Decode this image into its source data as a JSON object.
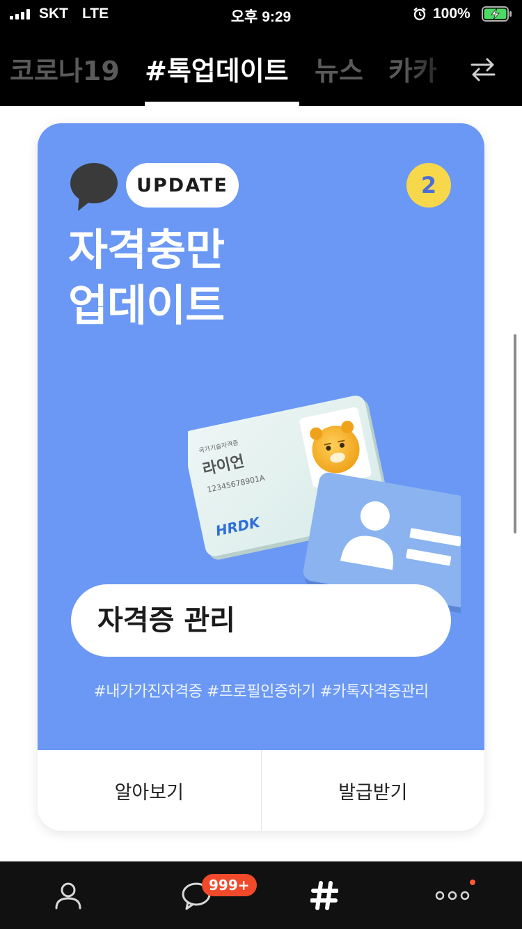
{
  "status_bar": {
    "carrier": "SKT",
    "network": "LTE",
    "time": "오후 9:29",
    "battery_percent": "100%",
    "battery_level": 1.0
  },
  "tabs": {
    "items": [
      {
        "label": "코로나19"
      },
      {
        "label": "#톡업데이트",
        "active": true
      },
      {
        "label": "뉴스"
      },
      {
        "label": "카카"
      }
    ],
    "swap_icon": "swap-arrows-icon"
  },
  "card": {
    "pill_label": "UPDATE",
    "page_number": "2",
    "title_line1": "자격충만",
    "title_line2": "업데이트",
    "illustration": {
      "card_header": "국가기술자격증",
      "card_name": "라이언",
      "card_number": "12345678901A",
      "card_brand": "HRDK"
    },
    "main_button_label": "자격증 관리",
    "hashtags": "#내가가진자격증 #프로필인증하기 #카톡자격증관리",
    "actions": [
      {
        "label": "알아보기"
      },
      {
        "label": "발급받기"
      }
    ],
    "colors": {
      "card_blue": "#6a98f4",
      "badge_yellow": "#f7d84b"
    }
  },
  "bottom_nav": {
    "chat_badge": "999+",
    "items": [
      "profile-icon",
      "chat-icon",
      "hashtag-icon",
      "more-icon"
    ]
  }
}
